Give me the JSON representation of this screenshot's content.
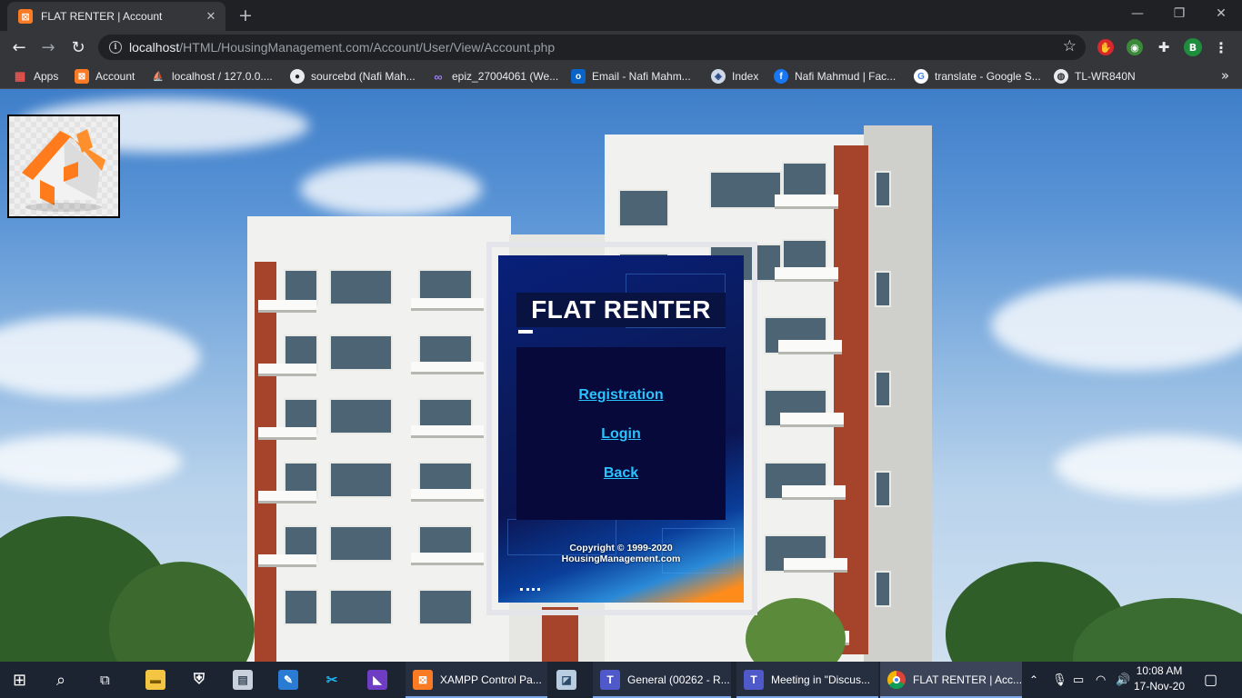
{
  "browser": {
    "tab_title": "FLAT RENTER | Account",
    "tab_favicon": "xampp-icon",
    "url_host": "localhost",
    "url_path": "/HTML/HousingManagement.com/Account/User/View/Account.php",
    "profile_initial": "B",
    "bookmarks": [
      {
        "label": "Apps",
        "icon": "apps-grid-icon"
      },
      {
        "label": "Account",
        "icon": "xampp-icon"
      },
      {
        "label": "localhost / 127.0.0....",
        "icon": "phpmyadmin-icon"
      },
      {
        "label": "sourcebd (Nafi Mah...",
        "icon": "github-icon"
      },
      {
        "label": "epiz_27004061 (We...",
        "icon": "infinityfree-icon"
      },
      {
        "label": "Email - Nafi Mahm...",
        "icon": "outlook-icon"
      },
      {
        "label": "Index",
        "icon": "shield-globe-icon"
      },
      {
        "label": "Nafi Mahmud | Fac...",
        "icon": "facebook-icon"
      },
      {
        "label": "translate - Google S...",
        "icon": "google-icon"
      },
      {
        "label": "TL-WR840N",
        "icon": "globe-icon"
      }
    ]
  },
  "card": {
    "title": "FLAT RENTER",
    "links": [
      "Registration",
      "Login",
      "Back"
    ],
    "copyright_line1": "Copyright © 1999-2020",
    "copyright_line2": "HousingManagement.com"
  },
  "taskbar": {
    "apps": [
      {
        "label": "XAMPP Control Pa...",
        "icon": "xampp-icon"
      },
      {
        "label": "General (00262 - R...",
        "icon": "teams-icon"
      },
      {
        "label": "Meeting in \"Discus...",
        "icon": "teams-icon"
      },
      {
        "label": "FLAT RENTER | Acc...",
        "icon": "chrome-icon"
      }
    ],
    "time": "10:08 AM",
    "date": "17-Nov-20"
  },
  "colors": {
    "link": "#29c4ff",
    "tab_bg": "#35363a",
    "taskbar_bg": "#1c2331",
    "xampp_orange": "#fb7a24"
  }
}
